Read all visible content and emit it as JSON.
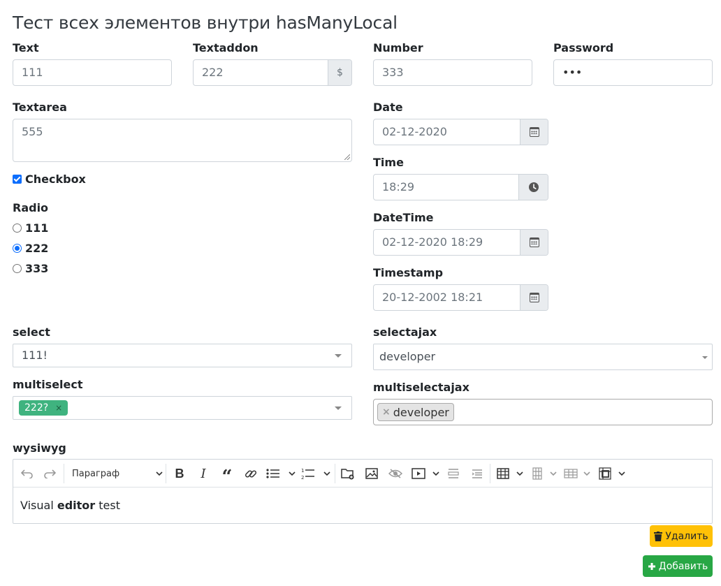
{
  "page_title": "Тест всех элементов внутри hasManyLocal",
  "fields": {
    "text": {
      "label": "Text",
      "value": "111"
    },
    "textaddon": {
      "label": "Textaddon",
      "value": "222",
      "addon": "$"
    },
    "number": {
      "label": "Number",
      "value": "333"
    },
    "password": {
      "label": "Password",
      "value": "•••"
    },
    "textarea": {
      "label": "Textarea",
      "value": "555"
    },
    "checkbox": {
      "label": "Checkbox",
      "checked": true
    },
    "radio": {
      "label": "Radio",
      "options": [
        "111",
        "222",
        "333"
      ],
      "selected": "222"
    },
    "date": {
      "label": "Date",
      "value": "02-12-2020",
      "icon": "calendar-icon"
    },
    "time": {
      "label": "Time",
      "value": "18:29",
      "icon": "clock-icon"
    },
    "datetime": {
      "label": "DateTime",
      "value": "02-12-2020 18:29",
      "icon": "calendar-icon"
    },
    "timestamp": {
      "label": "Timestamp",
      "value": "20-12-2002 18:21",
      "icon": "calendar-icon"
    },
    "select": {
      "label": "select",
      "value": "111!"
    },
    "selectajax": {
      "label": "selectajax",
      "value": "developer"
    },
    "multiselect": {
      "label": "multiselect",
      "tags": [
        "222?"
      ],
      "tag_remove": "×"
    },
    "multiselectajax": {
      "label": "multiselectajax",
      "tags": [
        "developer"
      ],
      "tag_remove": "×"
    },
    "wysiwyg": {
      "label": "wysiwyg",
      "heading_select": "Параграф",
      "content_plain": "Visual ",
      "content_bold": "editor",
      "content_tail": " test"
    }
  },
  "buttons": {
    "delete": "Удалить",
    "add": "Добавить"
  },
  "colors": {
    "primary": "#0d6efd",
    "tag_green": "#3fb37f",
    "warning": "#ffc107",
    "success": "#28a745"
  }
}
